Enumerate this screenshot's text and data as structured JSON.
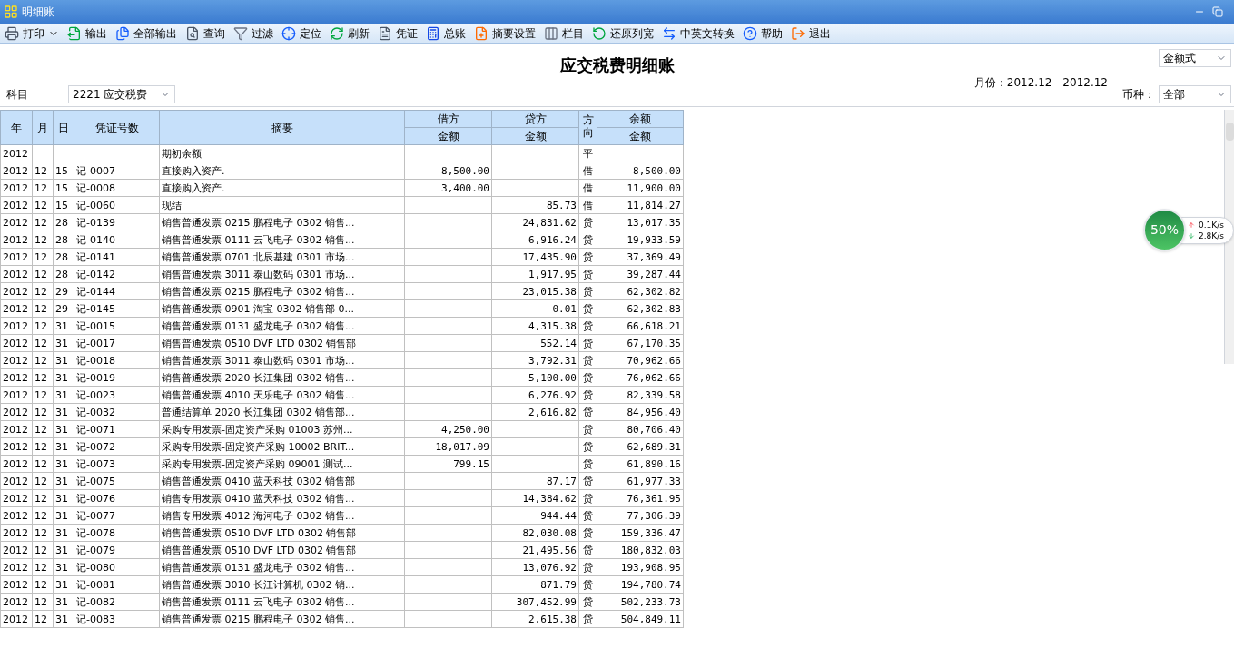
{
  "window": {
    "title": "明细账"
  },
  "toolbar": [
    {
      "label": "打印",
      "dropdown": true
    },
    {
      "label": "输出",
      "dropdown": false
    },
    {
      "label": "全部输出",
      "dropdown": false
    },
    {
      "label": "查询",
      "dropdown": false
    },
    {
      "label": "过滤",
      "dropdown": false
    },
    {
      "label": "定位",
      "dropdown": false
    },
    {
      "label": "刷新",
      "dropdown": false
    },
    {
      "label": "凭证",
      "dropdown": false
    },
    {
      "label": "总账",
      "dropdown": false
    },
    {
      "label": "摘要设置",
      "dropdown": false
    },
    {
      "label": "栏目",
      "dropdown": false
    },
    {
      "label": "还原列宽",
      "dropdown": false
    },
    {
      "label": "中英文转换",
      "dropdown": false
    },
    {
      "label": "帮助",
      "dropdown": false
    },
    {
      "label": "退出",
      "dropdown": false
    }
  ],
  "report": {
    "title": "应交税费明细账",
    "format_select": "金额式",
    "period": "月份：2012.12 - 2012.12",
    "subject_label": "科目",
    "subject_select": "2221 应交税费",
    "currency_label": "币种：",
    "currency_select": "全部"
  },
  "table": {
    "columns": [
      {
        "label": "年"
      },
      {
        "label": "月"
      },
      {
        "label": "日"
      },
      {
        "label": "凭证号数"
      },
      {
        "label": "摘要"
      },
      {
        "label": "借方",
        "sublabel": "金额"
      },
      {
        "label": "贷方",
        "sublabel": "金额"
      },
      {
        "label": "方向"
      },
      {
        "label": "余额",
        "sublabel": "金额"
      }
    ],
    "rows": [
      [
        "2012",
        null,
        null,
        null,
        "期初余额",
        null,
        null,
        "平",
        null
      ],
      [
        "2012",
        "12",
        "15",
        "记-0007",
        "直接购入资产.",
        "8,500.00",
        null,
        "借",
        "8,500.00"
      ],
      [
        "2012",
        "12",
        "15",
        "记-0008",
        "直接购入资产.",
        "3,400.00",
        null,
        "借",
        "11,900.00"
      ],
      [
        "2012",
        "12",
        "15",
        "记-0060",
        "现结",
        null,
        "85.73",
        "借",
        "11,814.27"
      ],
      [
        "2012",
        "12",
        "28",
        "记-0139",
        "销售普通发票 0215 鹏程电子 0302 销售...",
        null,
        "24,831.62",
        "贷",
        "13,017.35"
      ],
      [
        "2012",
        "12",
        "28",
        "记-0140",
        "销售普通发票 0111 云飞电子 0302 销售...",
        null,
        "6,916.24",
        "贷",
        "19,933.59"
      ],
      [
        "2012",
        "12",
        "28",
        "记-0141",
        "销售普通发票 0701 北辰基建 0301 市场...",
        null,
        "17,435.90",
        "贷",
        "37,369.49"
      ],
      [
        "2012",
        "12",
        "28",
        "记-0142",
        "销售普通发票 3011 泰山数码 0301 市场...",
        null,
        "1,917.95",
        "贷",
        "39,287.44"
      ],
      [
        "2012",
        "12",
        "29",
        "记-0144",
        "销售普通发票 0215 鹏程电子 0302 销售...",
        null,
        "23,015.38",
        "贷",
        "62,302.82"
      ],
      [
        "2012",
        "12",
        "29",
        "记-0145",
        "销售普通发票 0901 淘宝 0302 销售部 0...",
        null,
        "0.01",
        "贷",
        "62,302.83"
      ],
      [
        "2012",
        "12",
        "31",
        "记-0015",
        "销售普通发票 0131 盛龙电子 0302 销售...",
        null,
        "4,315.38",
        "贷",
        "66,618.21"
      ],
      [
        "2012",
        "12",
        "31",
        "记-0017",
        "销售普通发票 0510 DVF LTD 0302 销售部",
        null,
        "552.14",
        "贷",
        "67,170.35"
      ],
      [
        "2012",
        "12",
        "31",
        "记-0018",
        "销售普通发票 3011 泰山数码 0301 市场...",
        null,
        "3,792.31",
        "贷",
        "70,962.66"
      ],
      [
        "2012",
        "12",
        "31",
        "记-0019",
        "销售普通发票 2020 长江集团 0302 销售...",
        null,
        "5,100.00",
        "贷",
        "76,062.66"
      ],
      [
        "2012",
        "12",
        "31",
        "记-0023",
        "销售普通发票 4010 天乐电子 0302 销售...",
        null,
        "6,276.92",
        "贷",
        "82,339.58"
      ],
      [
        "2012",
        "12",
        "31",
        "记-0032",
        "普通结算单 2020 长江集团 0302 销售部...",
        null,
        "2,616.82",
        "贷",
        "84,956.40"
      ],
      [
        "2012",
        "12",
        "31",
        "记-0071",
        "采购专用发票-固定资产采购 01003 苏州...",
        "4,250.00",
        null,
        "贷",
        "80,706.40"
      ],
      [
        "2012",
        "12",
        "31",
        "记-0072",
        "采购专用发票-固定资产采购 10002 BRIT...",
        "18,017.09",
        null,
        "贷",
        "62,689.31"
      ],
      [
        "2012",
        "12",
        "31",
        "记-0073",
        "采购专用发票-固定资产采购 09001 测试...",
        "799.15",
        null,
        "贷",
        "61,890.16"
      ],
      [
        "2012",
        "12",
        "31",
        "记-0075",
        "销售普通发票 0410 蓝天科技 0302 销售部",
        null,
        "87.17",
        "贷",
        "61,977.33"
      ],
      [
        "2012",
        "12",
        "31",
        "记-0076",
        "销售专用发票 0410 蓝天科技 0302 销售...",
        null,
        "14,384.62",
        "贷",
        "76,361.95"
      ],
      [
        "2012",
        "12",
        "31",
        "记-0077",
        "销售专用发票 4012 海河电子 0302 销售...",
        null,
        "944.44",
        "贷",
        "77,306.39"
      ],
      [
        "2012",
        "12",
        "31",
        "记-0078",
        "销售普通发票 0510 DVF LTD 0302 销售部",
        null,
        "82,030.08",
        "贷",
        "159,336.47"
      ],
      [
        "2012",
        "12",
        "31",
        "记-0079",
        "销售普通发票 0510 DVF LTD 0302 销售部",
        null,
        "21,495.56",
        "贷",
        "180,832.03"
      ],
      [
        "2012",
        "12",
        "31",
        "记-0080",
        "销售普通发票 0131 盛龙电子 0302 销售...",
        null,
        "13,076.92",
        "贷",
        "193,908.95"
      ],
      [
        "2012",
        "12",
        "31",
        "记-0081",
        "销售普通发票 3010 长江计算机 0302 销...",
        null,
        "871.79",
        "贷",
        "194,780.74"
      ],
      [
        "2012",
        "12",
        "31",
        "记-0082",
        "销售普通发票 0111 云飞电子 0302 销售...",
        null,
        "307,452.99",
        "贷",
        "502,233.73"
      ],
      [
        "2012",
        "12",
        "31",
        "记-0083",
        "销售普通发票 0215 鹏程电子 0302 销售...",
        null,
        "2,615.38",
        "贷",
        "504,849.11"
      ]
    ]
  },
  "net_monitor": {
    "percent": "50%",
    "upload": "0.1K/s",
    "download": "2.8K/s"
  }
}
